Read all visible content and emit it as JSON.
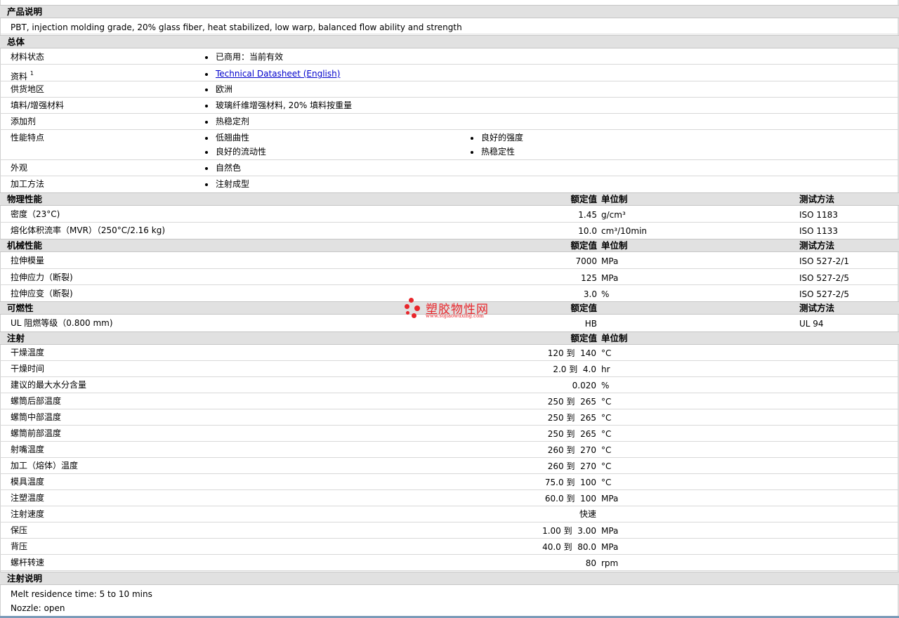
{
  "desc": {
    "header": "产品说明",
    "text": "PBT, injection molding grade, 20% glass fiber, heat stabilized, low warp, balanced flow ability and strength"
  },
  "general": {
    "header": "总体",
    "rows": [
      {
        "label": "材料状态",
        "value": "已商用：当前有效"
      },
      {
        "label": "资料",
        "sup": "1",
        "value": "Technical Datasheet (English)"
      },
      {
        "label": "供货地区",
        "value": "欧洲"
      },
      {
        "label": "填料/增强材料",
        "value": "玻璃纤维增强材料, 20% 填料按重量"
      },
      {
        "label": "添加剂",
        "value": "热稳定剂"
      },
      {
        "label": "性能特点",
        "values": [
          "低翘曲性",
          "良好的强度",
          "良好的流动性",
          "热稳定性"
        ]
      },
      {
        "label": "外观",
        "value": "自然色"
      },
      {
        "label": "加工方法",
        "value": "注射成型"
      }
    ]
  },
  "physical": {
    "header": "物理性能",
    "col_value": "额定值",
    "col_unit": "单位制",
    "col_method": "测试方法",
    "rows": [
      {
        "label": "密度（23°C)",
        "value": "1.45",
        "unit": "g/cm³",
        "method": "ISO 1183"
      },
      {
        "label": "熔化体积流率（MVR）（250°C/2.16 kg)",
        "value": "10.0",
        "unit": "cm³/10min",
        "method": "ISO 1133"
      }
    ]
  },
  "mechanical": {
    "header": "机械性能",
    "col_value": "额定值",
    "col_unit": "单位制",
    "col_method": "测试方法",
    "rows": [
      {
        "label": "拉伸模量",
        "value": "7000",
        "unit": "MPa",
        "method": "ISO 527-2/1"
      },
      {
        "label": "拉伸应力（断裂)",
        "value": "125",
        "unit": "MPa",
        "method": "ISO 527-2/5"
      },
      {
        "label": "拉伸应变（断裂)",
        "value": "3.0",
        "unit": "%",
        "method": "ISO 527-2/5"
      }
    ]
  },
  "flammability": {
    "header": "可燃性",
    "col_value": "额定值",
    "col_method": "测试方法",
    "rows": [
      {
        "label": "UL 阻燃等级（0.800 mm)",
        "value": "HB",
        "method": "UL 94"
      }
    ]
  },
  "injection": {
    "header": "注射",
    "col_value": "额定值",
    "col_unit": "单位制",
    "rows": [
      {
        "label": "干燥温度",
        "low": "120",
        "to": "到",
        "high": "140",
        "unit": "°C"
      },
      {
        "label": "干燥时间",
        "low": "2.0",
        "to": "到",
        "high": "4.0",
        "unit": "hr"
      },
      {
        "label": "建议的最大水分含量",
        "value": "0.020",
        "unit": "%"
      },
      {
        "label": "螺筒后部温度",
        "low": "250",
        "to": "到",
        "high": "265",
        "unit": "°C"
      },
      {
        "label": "螺筒中部温度",
        "low": "250",
        "to": "到",
        "high": "265",
        "unit": "°C"
      },
      {
        "label": "螺筒前部温度",
        "low": "250",
        "to": "到",
        "high": "265",
        "unit": "°C"
      },
      {
        "label": "射嘴温度",
        "low": "260",
        "to": "到",
        "high": "270",
        "unit": "°C"
      },
      {
        "label": "加工（熔体）温度",
        "low": "260",
        "to": "到",
        "high": "270",
        "unit": "°C"
      },
      {
        "label": "模具温度",
        "low": "75.0",
        "to": "到",
        "high": "100",
        "unit": "°C"
      },
      {
        "label": "注塑温度",
        "low": "60.0",
        "to": "到",
        "high": "100",
        "unit": "MPa"
      },
      {
        "label": "注射速度",
        "value": "快速",
        "unit": ""
      },
      {
        "label": "保压",
        "low": "1.00",
        "to": "到",
        "high": "3.00",
        "unit": "MPa"
      },
      {
        "label": "背压",
        "low": "40.0",
        "to": "到",
        "high": "80.0",
        "unit": "MPa"
      },
      {
        "label": "螺杆转速",
        "value": "80",
        "unit": "rpm"
      }
    ]
  },
  "notes": {
    "header": "注射说明",
    "lines": [
      "Melt residence time: 5 to 10 mins",
      "Nozzle: open"
    ]
  },
  "watermark": {
    "name": "塑胶物性网",
    "url": "www.sujiaowuxing.com",
    "color": "#e8262b"
  }
}
